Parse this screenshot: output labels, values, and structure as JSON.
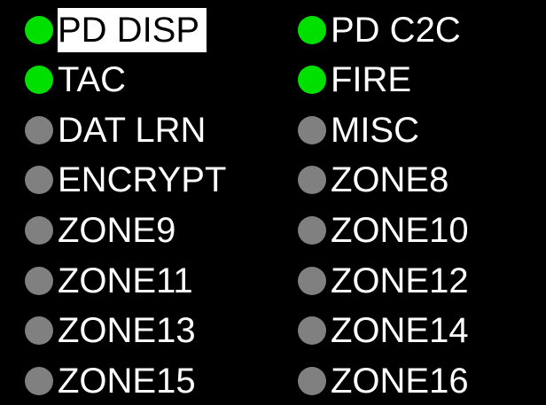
{
  "colors": {
    "background": "#000000",
    "label_text": "#ffffff",
    "indicator_on": "#00e000",
    "indicator_off": "#808080",
    "selected_bg": "#ffffff",
    "selected_text": "#000000"
  },
  "channels": [
    {
      "label": "PD DISP",
      "active": true,
      "selected": true
    },
    {
      "label": "PD C2C",
      "active": true,
      "selected": false
    },
    {
      "label": "TAC",
      "active": true,
      "selected": false
    },
    {
      "label": "FIRE",
      "active": true,
      "selected": false
    },
    {
      "label": "DAT LRN",
      "active": false,
      "selected": false
    },
    {
      "label": "MISC",
      "active": false,
      "selected": false
    },
    {
      "label": "ENCRYPT",
      "active": false,
      "selected": false
    },
    {
      "label": "ZONE8",
      "active": false,
      "selected": false
    },
    {
      "label": "ZONE9",
      "active": false,
      "selected": false
    },
    {
      "label": "ZONE10",
      "active": false,
      "selected": false
    },
    {
      "label": "ZONE11",
      "active": false,
      "selected": false
    },
    {
      "label": "ZONE12",
      "active": false,
      "selected": false
    },
    {
      "label": "ZONE13",
      "active": false,
      "selected": false
    },
    {
      "label": "ZONE14",
      "active": false,
      "selected": false
    },
    {
      "label": "ZONE15",
      "active": false,
      "selected": false
    },
    {
      "label": "ZONE16",
      "active": false,
      "selected": false
    }
  ]
}
